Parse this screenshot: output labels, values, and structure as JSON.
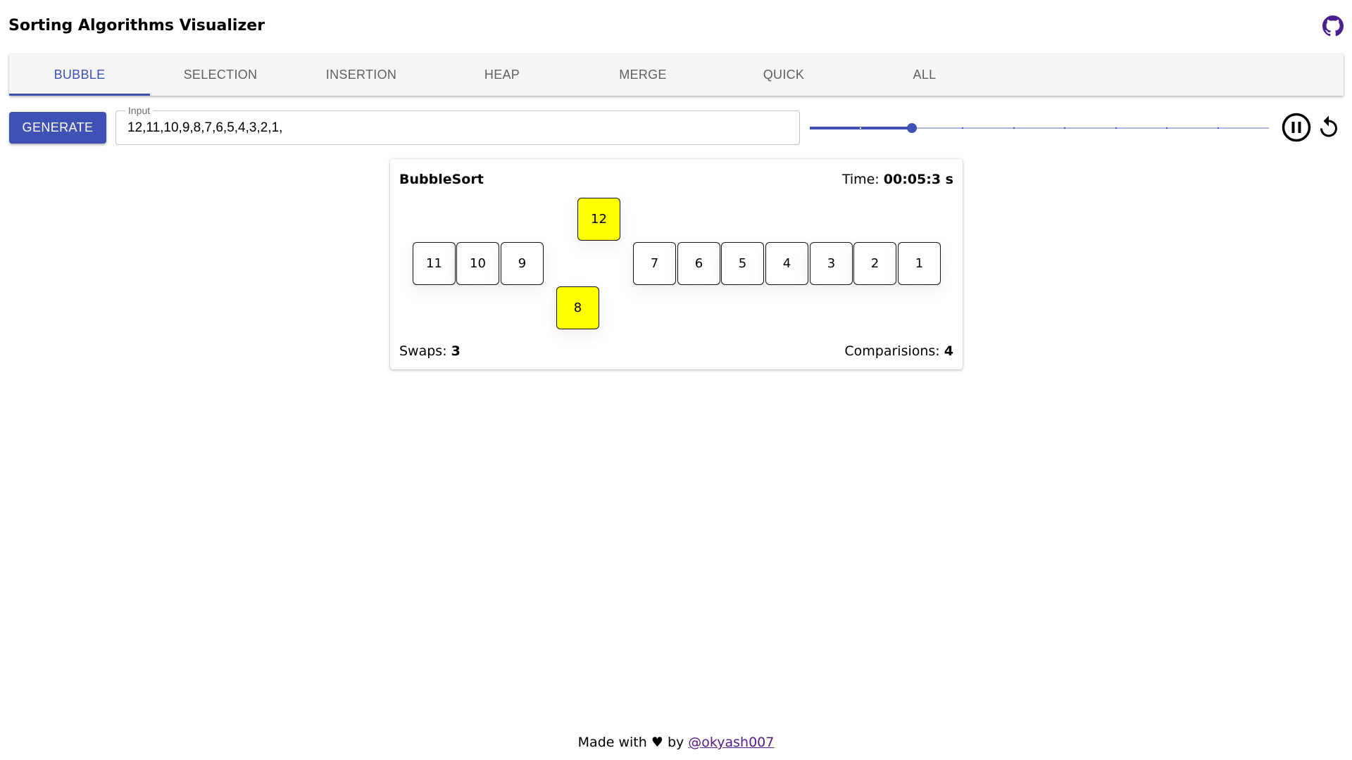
{
  "header": {
    "title": "Sorting Algorithms Visualizer",
    "github_icon": "github-icon",
    "github_color": "#4b1f8f"
  },
  "tabs": [
    {
      "label": "BUBBLE",
      "active": true
    },
    {
      "label": "SELECTION",
      "active": false
    },
    {
      "label": "INSERTION",
      "active": false
    },
    {
      "label": "HEAP",
      "active": false
    },
    {
      "label": "MERGE",
      "active": false
    },
    {
      "label": "QUICK",
      "active": false
    },
    {
      "label": "ALL",
      "active": false
    }
  ],
  "controls": {
    "generate_label": "GENERATE",
    "input_label": "Input",
    "input_value": "12,11,10,9,8,7,6,5,4,3,2,1,",
    "speed_slider": {
      "steps": 10,
      "value": 2
    },
    "pause_icon": "pause-circle-icon",
    "restart_icon": "restart-icon"
  },
  "visualizer": {
    "title": "BubbleSort",
    "time_label": "Time:",
    "time_value": "00:05:3 s",
    "swaps_label": "Swaps:",
    "swaps_value": "3",
    "comparisons_label": "Comparisions:",
    "comparisons_value": "4",
    "items": [
      {
        "value": "11",
        "highlighted": false,
        "offset": "none"
      },
      {
        "value": "10",
        "highlighted": false,
        "offset": "none"
      },
      {
        "value": "9",
        "highlighted": false,
        "offset": "none"
      },
      {
        "value": "8",
        "highlighted": true,
        "offset": "down"
      },
      {
        "value": "12",
        "highlighted": true,
        "offset": "up"
      },
      {
        "value": "7",
        "highlighted": false,
        "offset": "none"
      },
      {
        "value": "6",
        "highlighted": false,
        "offset": "none"
      },
      {
        "value": "5",
        "highlighted": false,
        "offset": "none"
      },
      {
        "value": "4",
        "highlighted": false,
        "offset": "none"
      },
      {
        "value": "3",
        "highlighted": false,
        "offset": "none"
      },
      {
        "value": "2",
        "highlighted": false,
        "offset": "none"
      },
      {
        "value": "1",
        "highlighted": false,
        "offset": "none"
      }
    ],
    "highlight_color": "#ffff00"
  },
  "footer": {
    "prefix": "Made with",
    "heart": "♥",
    "by": "by",
    "link_text": "@okyash007"
  },
  "theme": {
    "primary": "#3f51b5"
  }
}
